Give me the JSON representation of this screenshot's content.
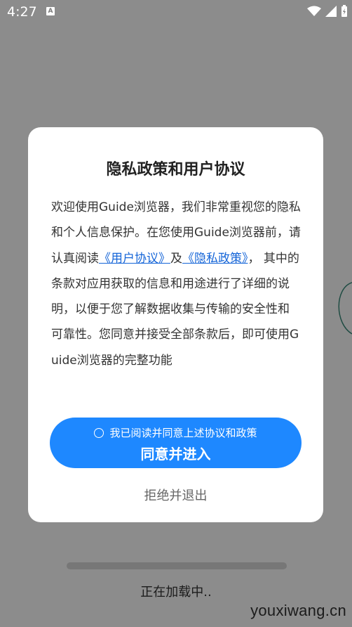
{
  "status_bar": {
    "time": "4:27",
    "notification_icon": "A"
  },
  "background": {
    "loading_text": "正在加载中..",
    "watermark": "youxiwang.cn"
  },
  "dialog": {
    "title": "隐私政策和用户协议",
    "body": {
      "text_before": "欢迎使用Guide浏览器，我们非常重视您的隐私和个人信息保护。在您使用Guide浏览器前，请认真阅读",
      "link_user_agreement": "《用户协议》",
      "and": "及",
      "link_privacy_policy": "《隐私政策》",
      "text_after": "， 其中的条款对应用获取的信息和用途进行了详细的说明，以便于您了解数据收集与传输的安全性和可靠性。您同意并接受全部条款后，即可使用Guide浏览器的完整功能"
    },
    "agree_checkbox_label": "我已阅读并同意上述协议和政策",
    "agree_button": "同意并进入",
    "reject_button": "拒绝并退出"
  },
  "colors": {
    "primary_button": "#1e88ff",
    "link": "#1565d8",
    "overlay": "rgba(0,0,0,0.45)"
  }
}
